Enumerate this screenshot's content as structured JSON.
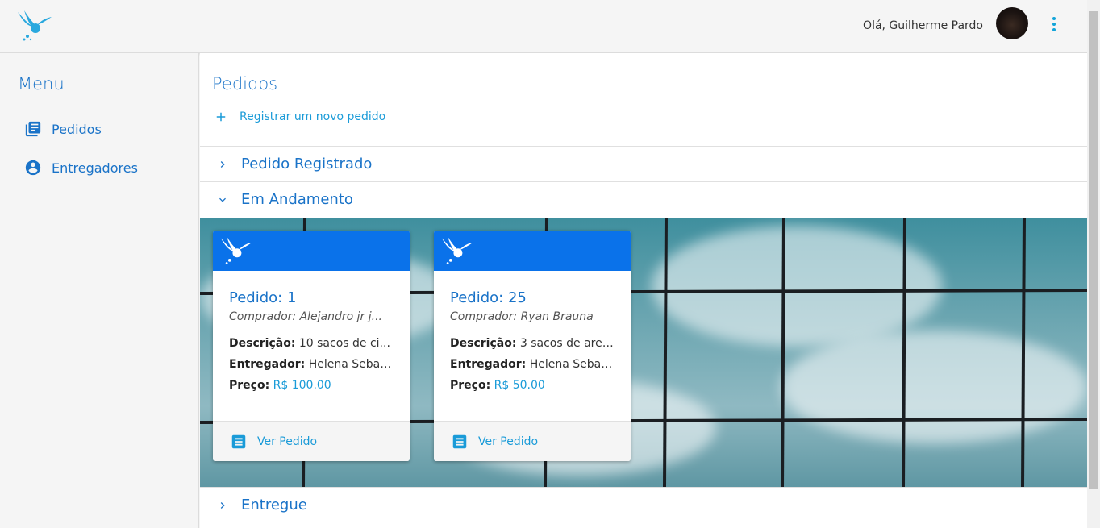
{
  "header": {
    "greeting": "Olá, Guilherme Pardo",
    "logo_icon": "fairy-bird-logo-icon",
    "menu_icon": "more-vertical-icon"
  },
  "sidebar": {
    "title": "Menu",
    "items": [
      {
        "label": "Pedidos",
        "icon": "list-icon"
      },
      {
        "label": "Entregadores",
        "icon": "account-circle-icon"
      }
    ]
  },
  "main": {
    "title": "Pedidos",
    "new_order_label": "Registrar um novo pedido",
    "sections": [
      {
        "label": "Pedido Registrado",
        "expanded": false
      },
      {
        "label": "Em Andamento",
        "expanded": true
      },
      {
        "label": "Entregue",
        "expanded": false
      }
    ],
    "cards": [
      {
        "title": "Pedido: 1",
        "buyer": "Comprador: Alejandro jr j...",
        "desc_label": "Descrição:",
        "desc_value": "10 sacos de ci...",
        "courier_label": "Entregador:",
        "courier_value": "Helena Sebas...",
        "price_label": "Preço:",
        "price_value": "R$ 100.00",
        "action_label": "Ver Pedido"
      },
      {
        "title": "Pedido: 25",
        "buyer": "Comprador: Ryan Brauna",
        "desc_label": "Descrição:",
        "desc_value": "3 sacos de arei...",
        "courier_label": "Entregador:",
        "courier_value": "Helena Sebas...",
        "price_label": "Preço:",
        "price_value": "R$ 50.00",
        "action_label": "Ver Pedido"
      }
    ]
  },
  "colors": {
    "accent": "#1a73c8",
    "link": "#1a9bd8",
    "card_header": "#0a72ea"
  }
}
